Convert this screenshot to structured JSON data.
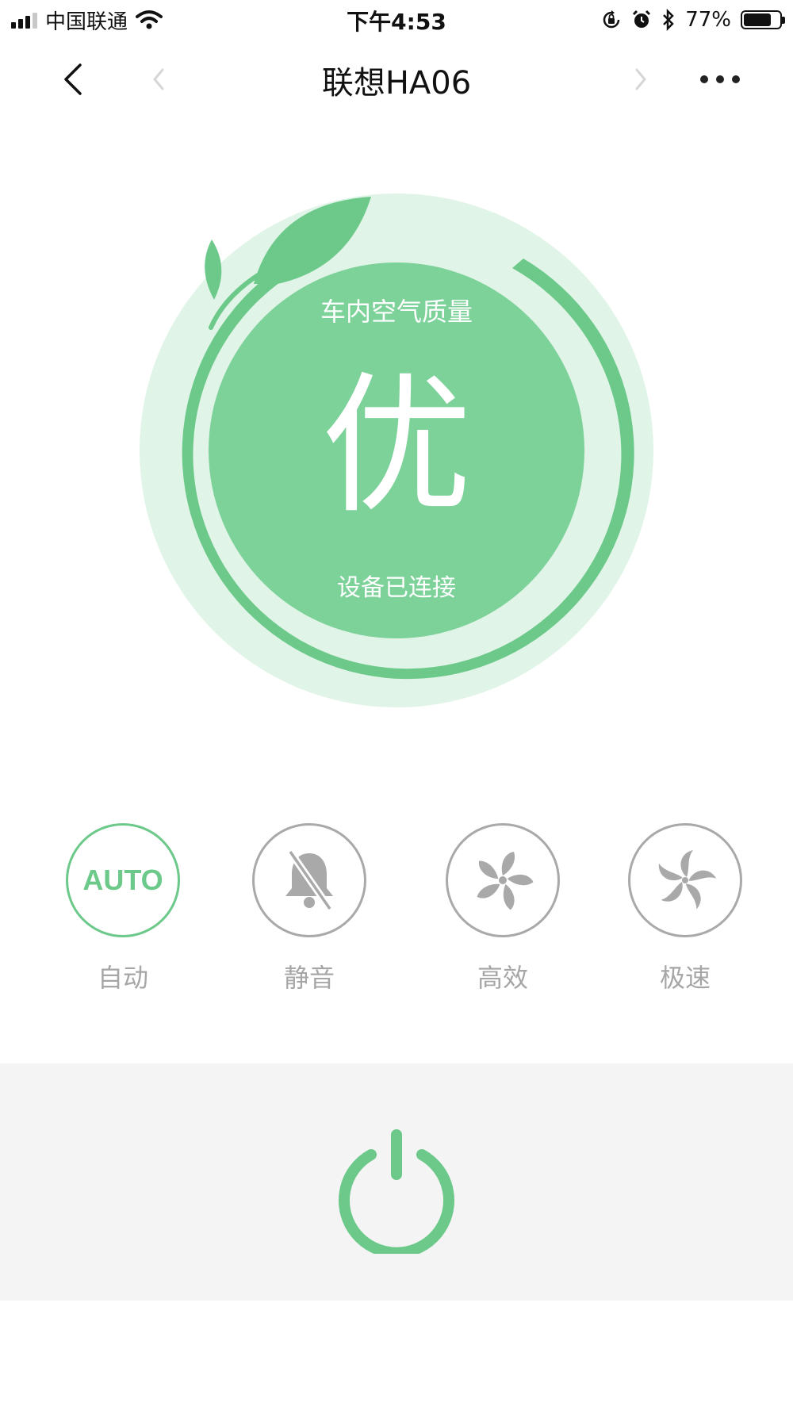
{
  "status_bar": {
    "carrier": "中国联通",
    "time": "下午4:53",
    "battery_percent": "77%",
    "battery_level": 0.77,
    "icons": [
      "signal-icon",
      "wifi-icon",
      "rotation-lock-icon",
      "alarm-icon",
      "bluetooth-icon",
      "battery-icon"
    ]
  },
  "nav": {
    "title": "联想HA06",
    "icons": [
      "back-icon",
      "prev-icon",
      "next-icon",
      "more-icon"
    ]
  },
  "air_quality": {
    "label": "车内空气质量",
    "value": "优",
    "connection_status": "设备已连接"
  },
  "modes": [
    {
      "label": "自动",
      "icon_text": "AUTO",
      "icon": "auto-icon",
      "active": true
    },
    {
      "label": "静音",
      "icon": "mute-bell-icon",
      "active": false
    },
    {
      "label": "高效",
      "icon": "fan-icon",
      "active": false
    },
    {
      "label": "极速",
      "icon": "turbo-fan-icon",
      "active": false
    }
  ],
  "power": {
    "icon": "power-icon"
  },
  "colors": {
    "accent": "#6cc98a",
    "hero_inner": "#7dd29a",
    "hero_outer": "#e0f4e7",
    "inactive": "#a9a9a9",
    "label": "#a6a6a6",
    "power_bg": "#f4f4f4"
  }
}
